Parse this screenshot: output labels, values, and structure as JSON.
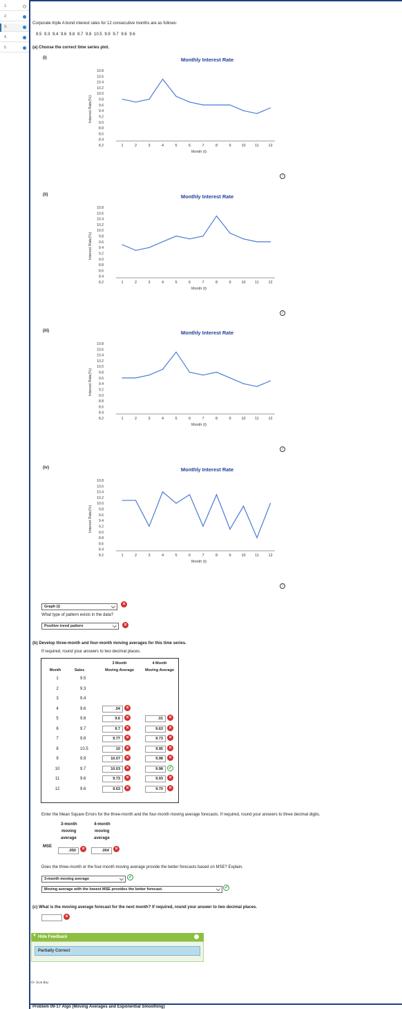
{
  "nav": {
    "items": [
      {
        "num": "1.",
        "status": "empty"
      },
      {
        "num": "2.",
        "status": "answered"
      },
      {
        "num": "3.",
        "status": "partial"
      },
      {
        "num": "4.",
        "status": "answered"
      },
      {
        "num": "5.",
        "status": "answered"
      }
    ]
  },
  "question": {
    "intro": "Corporate triple A bond interest rates for 12 consecutive months are as follows:",
    "series_text": "9.5   9.3   9.4   9.6   9.8   9.7   9.8   10.5   9.9   9.7   9.6   9.6",
    "part_a": "(a) Choose the correct time series plot."
  },
  "charts": {
    "labels": [
      "(i)",
      "(ii)",
      "(iii)",
      "(iv)"
    ],
    "title": "Monthly Interest Rate",
    "ylabel": "Interest Rate(%)",
    "xlabel": "Month (t)",
    "yticks": [
      "10.8",
      "10.6",
      "10.4",
      "10.2",
      "10.0",
      "9.8",
      "9.6",
      "9.4",
      "9.2",
      "9.0",
      "8.8",
      "8.6",
      "8.4",
      "8.2"
    ],
    "xticks": [
      "1",
      "2",
      "3",
      "4",
      "5",
      "6",
      "7",
      "8",
      "9",
      "10",
      "11",
      "12"
    ],
    "info_icon": "i"
  },
  "chart_data": [
    {
      "type": "line",
      "title": "Monthly Interest Rate",
      "xlabel": "Month (t)",
      "ylabel": "Interest Rate(%)",
      "x": [
        1,
        2,
        3,
        4,
        5,
        6,
        7,
        8,
        9,
        10,
        11,
        12
      ],
      "values": [
        9.8,
        9.7,
        9.8,
        10.5,
        9.9,
        9.7,
        9.6,
        9.6,
        9.6,
        9.4,
        9.3,
        9.5
      ],
      "ylim": [
        8.2,
        10.8
      ]
    },
    {
      "type": "line",
      "title": "Monthly Interest Rate",
      "xlabel": "Month (t)",
      "ylabel": "Interest Rate(%)",
      "x": [
        1,
        2,
        3,
        4,
        5,
        6,
        7,
        8,
        9,
        10,
        11,
        12
      ],
      "values": [
        9.5,
        9.3,
        9.4,
        9.6,
        9.8,
        9.7,
        9.8,
        10.5,
        9.9,
        9.7,
        9.6,
        9.6
      ],
      "ylim": [
        8.2,
        10.8
      ]
    },
    {
      "type": "line",
      "title": "Monthly Interest Rate",
      "xlabel": "Month (t)",
      "ylabel": "Interest Rate(%)",
      "x": [
        1,
        2,
        3,
        4,
        5,
        6,
        7,
        8,
        9,
        10,
        11,
        12
      ],
      "values": [
        9.6,
        9.6,
        9.7,
        9.9,
        10.5,
        9.8,
        9.7,
        9.8,
        9.6,
        9.4,
        9.3,
        9.5
      ],
      "ylim": [
        8.2,
        10.8
      ]
    },
    {
      "type": "line",
      "title": "Monthly Interest Rate",
      "xlabel": "Month (t)",
      "ylabel": "Interest Rate(%)",
      "x": [
        1,
        2,
        3,
        4,
        5,
        6,
        7,
        8,
        9,
        10,
        11,
        12
      ],
      "values": [
        10.1,
        10.1,
        9.2,
        10.4,
        10.0,
        10.3,
        9.2,
        10.3,
        9.1,
        9.9,
        8.8,
        10.0
      ],
      "ylim": [
        8.2,
        10.8
      ]
    }
  ],
  "answers_a": {
    "graph_select": "Graph (i)",
    "pattern_question": "What type of pattern exists in the data?",
    "pattern_select": "Positive trend pattern"
  },
  "part_b": {
    "heading": "(b) Develop three-month and four-month moving averages for this time series.",
    "instruction": "If required, round your answers to two decimal places.",
    "headers": {
      "month": "Month",
      "sales": "Sales",
      "ma3_line1": "3 Month",
      "ma3_line2": "Moving Average",
      "ma4_line1": "4 Month",
      "ma4_line2": "Moving Average"
    },
    "rows": [
      {
        "month": "1",
        "sales": "9.5",
        "ma3": "",
        "ma3_status": "",
        "ma4": "",
        "ma4_status": ""
      },
      {
        "month": "2",
        "sales": "9.3",
        "ma3": "",
        "ma3_status": "",
        "ma4": "",
        "ma4_status": ""
      },
      {
        "month": "3",
        "sales": "9.4",
        "ma3": "",
        "ma3_status": "",
        "ma4": "",
        "ma4_status": ""
      },
      {
        "month": "4",
        "sales": "9.6",
        "ma3": ".04",
        "ma3_status": "wrong",
        "ma4": "",
        "ma4_status": ""
      },
      {
        "month": "5",
        "sales": "9.8",
        "ma3": "9.6",
        "ma3_status": "wrong",
        "ma4": ".01",
        "ma4_status": "wrong"
      },
      {
        "month": "6",
        "sales": "9.7",
        "ma3": "9.7",
        "ma3_status": "wrong",
        "ma4": "9.63",
        "ma4_status": "wrong"
      },
      {
        "month": "7",
        "sales": "9.8",
        "ma3": "9.77",
        "ma3_status": "wrong",
        "ma4": "9.73",
        "ma4_status": "wrong"
      },
      {
        "month": "8",
        "sales": "10.5",
        "ma3": "10",
        "ma3_status": "wrong",
        "ma4": "9.95",
        "ma4_status": "wrong"
      },
      {
        "month": "9",
        "sales": "9.9",
        "ma3": "10.07",
        "ma3_status": "wrong",
        "ma4": "9.98",
        "ma4_status": "wrong"
      },
      {
        "month": "10",
        "sales": "9.7",
        "ma3": "10.03",
        "ma3_status": "wrong",
        "ma4": "9.98",
        "ma4_status": "correct"
      },
      {
        "month": "11",
        "sales": "9.6",
        "ma3": "9.73",
        "ma3_status": "wrong",
        "ma4": "9.93",
        "ma4_status": "wrong"
      },
      {
        "month": "12",
        "sales": "9.6",
        "ma3": "9.63",
        "ma3_status": "wrong",
        "ma4": "9.70",
        "ma4_status": "wrong"
      }
    ]
  },
  "mse": {
    "instruction": "Enter the Mean Square Errors for the three-month and the four-month moving average forecasts. If required, round your answers to three decimal digits.",
    "col3_line1": "3-month",
    "col3_line2": "moving",
    "col3_line3": "average",
    "col4_line1": "4-month",
    "col4_line2": "moving",
    "col4_line3": "average",
    "row_label": "MSE",
    "ma3_value": ".050",
    "ma4_value": ".064",
    "question": "Does the three-month or the four-month moving average provide the better forecasts based on MSE? Explain.",
    "select1": "3-month moving average",
    "select2": "Moving average with the lowest MSE provides the better forecast."
  },
  "part_c": {
    "question": "(c) What is the moving average forecast for the next month? If required, round your answer to two decimal places.",
    "value": ""
  },
  "feedback": {
    "toggle": "Hide Feedback",
    "status": "Partially Correct"
  },
  "footer": {
    "icon_key": "Icon Key",
    "problem_title": "Problem 09-17 Algo (Moving Averages and Exponential Smoothing)"
  },
  "colors": {
    "line": "#4a78d4",
    "frame": "#1f3f7a",
    "wrong": "#d32f2f",
    "correct": "#2e9e3e",
    "feedback_bar": "#8cbf3f"
  }
}
